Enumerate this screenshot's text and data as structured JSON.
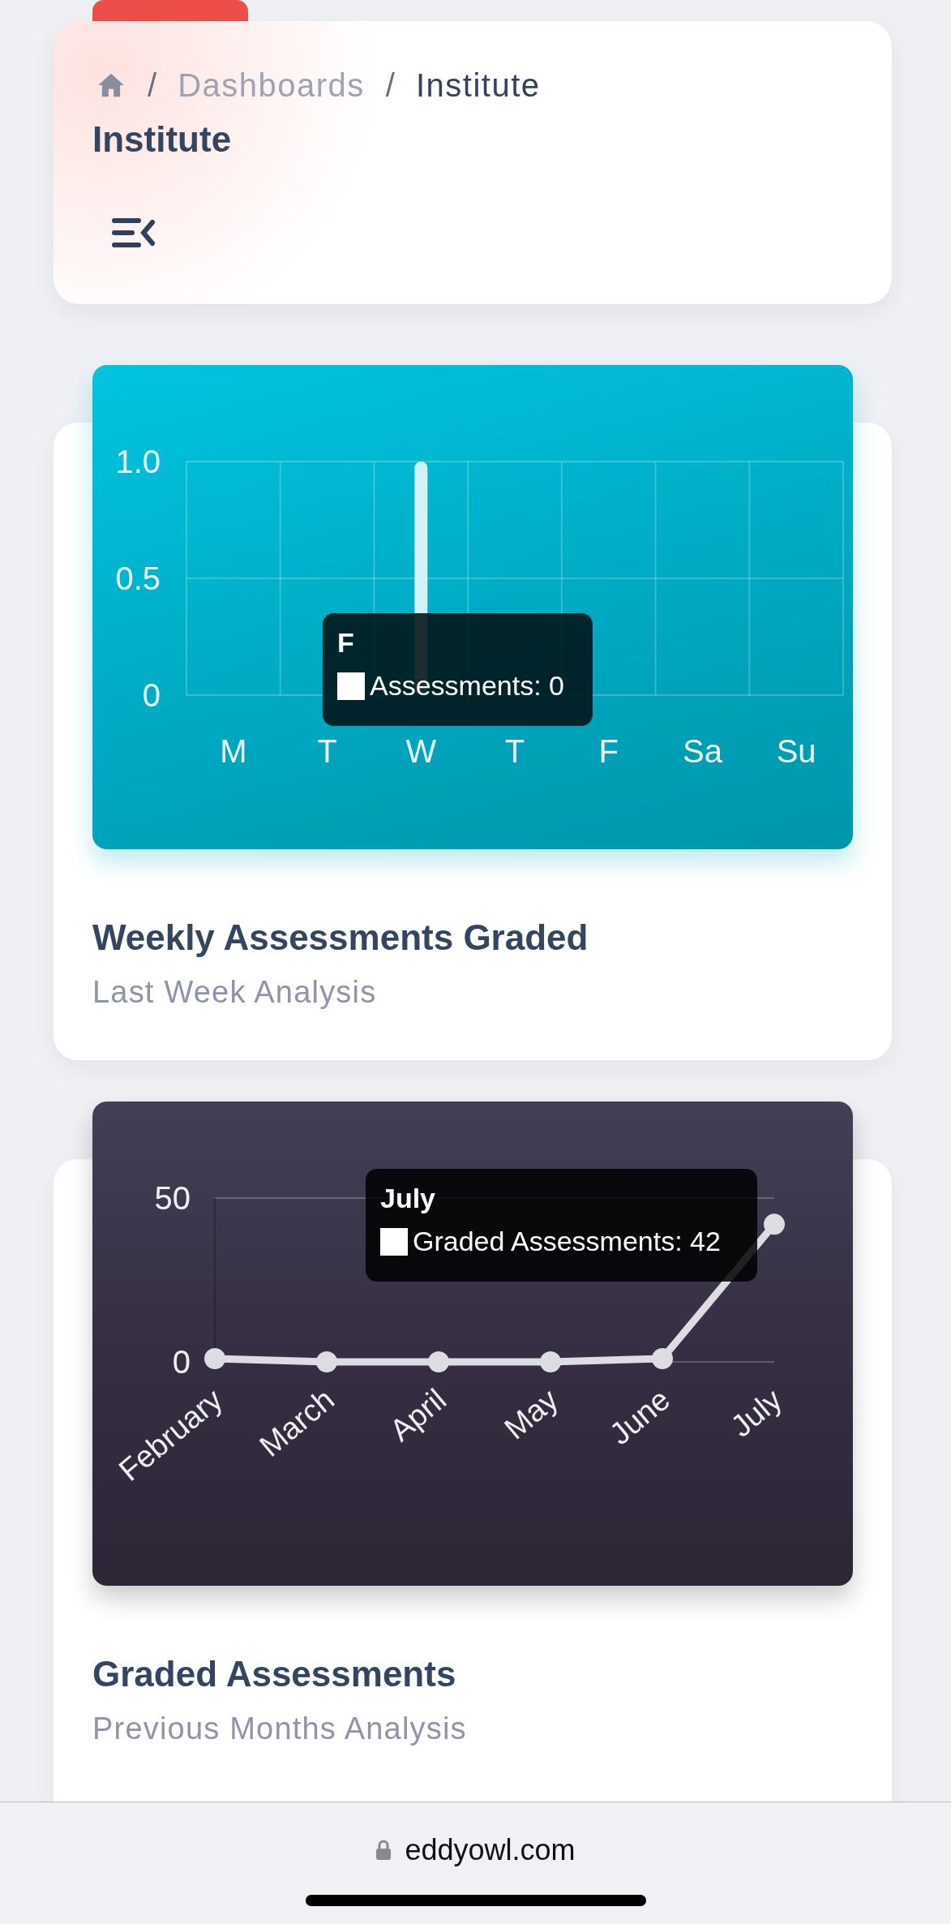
{
  "breadcrumb": {
    "items": [
      {
        "separator": "/",
        "label": "Dashboards",
        "current": false
      },
      {
        "separator": "/",
        "label": "Institute",
        "current": true
      }
    ]
  },
  "page_title": "Institute",
  "cards": [
    {
      "tooltip": {
        "title": "F",
        "text": "Assessments: 0"
      },
      "chart_data": {
        "type": "bar",
        "categories": [
          "M",
          "T",
          "W",
          "T",
          "F",
          "Sa",
          "Su"
        ],
        "series": [
          {
            "color": "#d4f2f6",
            "values": [
              0,
              0,
              1,
              0,
              0,
              0,
              0
            ]
          }
        ],
        "ylim": [
          0,
          1
        ],
        "yticks": [
          0,
          0.5,
          {
            "value": 1,
            "label": "1.0"
          }
        ]
      },
      "title": "Weekly Assessments Graded",
      "subtitle": "Last Week Analysis"
    },
    {
      "tooltip": {
        "title": "July",
        "text": "Graded Assessments: 42"
      },
      "chart_data": {
        "type": "line",
        "categories": [
          "February",
          "March",
          "April",
          "May",
          "June",
          "July"
        ],
        "series": [
          {
            "color": "#dcdce2",
            "marker": true,
            "values": [
              1,
              0,
              0,
              0,
              1,
              42
            ]
          }
        ],
        "ylim": [
          0,
          50
        ],
        "yticks": [
          0,
          50
        ]
      },
      "title": "Graded Assessments",
      "subtitle": "Previous Months Analysis"
    }
  ],
  "browser": {
    "url": "eddyowl.com"
  }
}
